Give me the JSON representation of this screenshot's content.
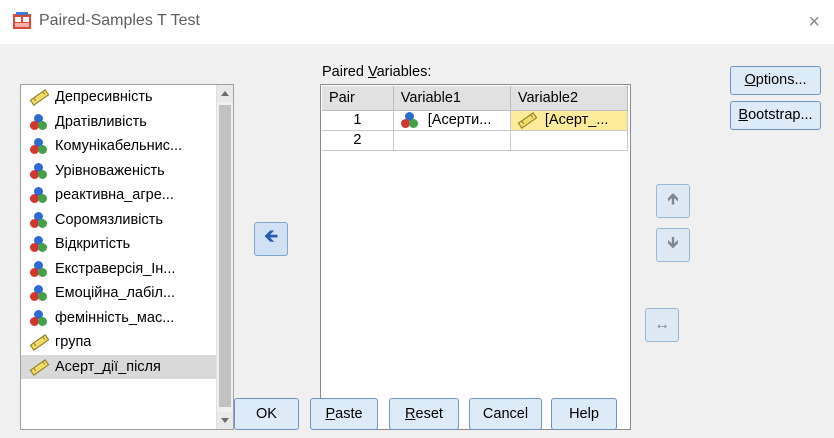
{
  "window": {
    "title": "Paired-Samples T Test",
    "close_glyph": "×"
  },
  "source_list": {
    "items": [
      {
        "label": "Депресивність",
        "icon": "scale-ruler-icon"
      },
      {
        "label": "Дратівливість",
        "icon": "nominal-icon"
      },
      {
        "label": "Комунікабельнис...",
        "icon": "nominal-icon"
      },
      {
        "label": "Урівноваженість",
        "icon": "nominal-icon"
      },
      {
        "label": "реактивна_агре...",
        "icon": "nominal-icon"
      },
      {
        "label": "Соромязливість",
        "icon": "nominal-icon"
      },
      {
        "label": "Відкритість",
        "icon": "nominal-icon"
      },
      {
        "label": "Екстраверсія_Ін...",
        "icon": "nominal-icon"
      },
      {
        "label": "Емоційна_лабіл...",
        "icon": "nominal-icon"
      },
      {
        "label": "фемінність_мас...",
        "icon": "nominal-icon"
      },
      {
        "label": "група",
        "icon": "scale-ruler-icon"
      },
      {
        "label": "Асерт_дії_після",
        "icon": "scale-ruler-icon",
        "selected": true
      }
    ]
  },
  "paired": {
    "label_pre": "Paired ",
    "label_ul": "V",
    "label_post": "ariables:",
    "headers": {
      "pair": "Pair",
      "var1": "Variable1",
      "var2": "Variable2"
    },
    "rows": [
      {
        "pair": "1",
        "var1": "[Асерти...",
        "var1_icon": "nominal-icon",
        "var2": "[Асерт_...",
        "var2_icon": "scale-ruler-icon"
      },
      {
        "pair": "2",
        "var1": "",
        "var2": ""
      }
    ]
  },
  "arrows": {
    "move": "🡸",
    "up": "🡹",
    "down": "🡻",
    "swap": "↔"
  },
  "side_buttons": {
    "options": {
      "ul": "O",
      "rest": "ptions..."
    },
    "bootstrap": {
      "ul": "B",
      "rest": "ootstrap..."
    }
  },
  "bottom_buttons": {
    "ok": "OK",
    "paste": {
      "ul": "P",
      "rest": "aste"
    },
    "reset": {
      "ul": "R",
      "rest": "eset"
    },
    "cancel": "Cancel",
    "help": "Help"
  },
  "colors": {
    "selected_cell": "#ffeb9c",
    "button_bg": "#ddeaf8",
    "button_border": "#6c94c4",
    "dialog_bg": "#f0f0f0"
  }
}
